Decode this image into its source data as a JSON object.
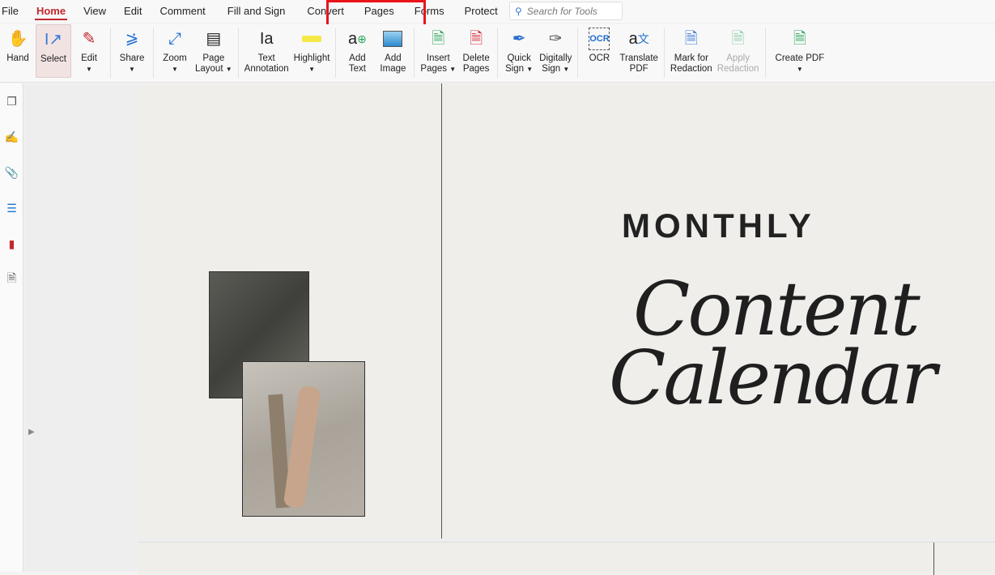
{
  "menu": [
    "File",
    "Home",
    "View",
    "Edit",
    "Comment",
    "Fill and Sign",
    "Convert",
    "Pages",
    "Forms",
    "Protect"
  ],
  "search_placeholder": "Search for Tools",
  "tools": {
    "hand": "Hand",
    "select": "Select",
    "edit": "Edit",
    "share": "Share",
    "zoom": "Zoom",
    "page_layout": [
      "Page",
      "Layout"
    ],
    "text_annotation": [
      "Text",
      "Annotation"
    ],
    "highlight": "Highlight",
    "add_text": [
      "Add",
      "Text"
    ],
    "add_image": [
      "Add",
      "Image"
    ],
    "insert_pages": [
      "Insert",
      "Pages"
    ],
    "delete_pages": [
      "Delete",
      "Pages"
    ],
    "quick_sign": [
      "Quick",
      "Sign"
    ],
    "digitally_sign": [
      "Digitally",
      "Sign"
    ],
    "ocr": "OCR",
    "translate_pdf": [
      "Translate",
      "PDF"
    ],
    "mark_redaction": [
      "Mark for",
      "Redaction"
    ],
    "apply_redaction": [
      "Apply",
      "Redaction"
    ],
    "create_pdf": "Create PDF"
  },
  "document": {
    "monthly": "MONTHLY",
    "title_line1": "Content",
    "title_line2": "Calendar"
  },
  "colors": {
    "accent": "#c1282d",
    "highlight_box": "#e8141b"
  }
}
